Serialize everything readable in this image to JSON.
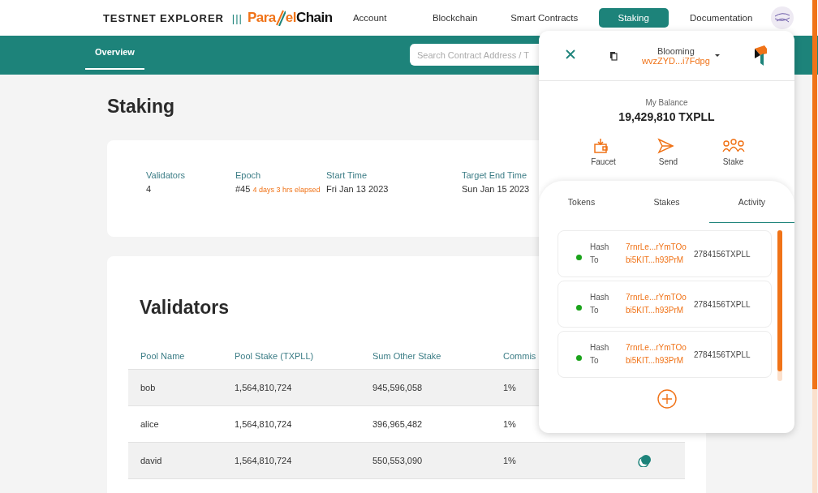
{
  "header": {
    "brand": "TESTNET EXPLORER",
    "separator": "|||",
    "logo": {
      "lead": "Para",
      "mid": "el",
      "tail": "Chain"
    },
    "nav": [
      {
        "label": "Account",
        "selected": false
      },
      {
        "label": "Blockchain",
        "selected": false
      },
      {
        "label": "Smart Contracts",
        "selected": false
      },
      {
        "label": "Staking",
        "selected": true
      },
      {
        "label": "Documentation",
        "selected": false
      }
    ]
  },
  "subnav": {
    "tabs": [
      {
        "label": "Overview",
        "selected": true
      }
    ],
    "search": {
      "placeholder": "Search Contract Address / T"
    }
  },
  "page": {
    "title": "Staking",
    "stats": [
      {
        "label": "Validators",
        "value": "4"
      },
      {
        "label": "Epoch",
        "value": "#45",
        "note": "4 days 3 hrs elapsed"
      },
      {
        "label": "Start Time",
        "value": "Fri Jan 13 2023"
      },
      {
        "label": "Target End Time",
        "value": "Sun Jan 15 2023"
      }
    ],
    "validators": {
      "title": "Validators",
      "columns": [
        "Pool Name",
        "Pool Stake (TXPLL)",
        "Sum Other Stake",
        "Commis"
      ],
      "rows": [
        {
          "cells": [
            "bob",
            "1,564,810,724",
            "945,596,058",
            "1%"
          ],
          "action_icon": false
        },
        {
          "cells": [
            "alice",
            "1,564,810,724",
            "396,965,482",
            "1%"
          ],
          "action_icon": false
        },
        {
          "cells": [
            "david",
            "1,564,810,724",
            "550,553,090",
            "1%"
          ],
          "action_icon": true
        }
      ]
    }
  },
  "wallet": {
    "network": "Blooming",
    "address": "wvzZYD...i7Fdpg",
    "balance_label": "My Balance",
    "balance": "19,429,810 TXPLL",
    "actions": [
      {
        "label": "Faucet",
        "kind": "faucet"
      },
      {
        "label": "Send",
        "kind": "send"
      },
      {
        "label": "Stake",
        "kind": "stake"
      }
    ],
    "tabs": [
      {
        "label": "Tokens",
        "selected": false
      },
      {
        "label": "Stakes",
        "selected": false
      },
      {
        "label": "Activity",
        "selected": true
      }
    ],
    "activity": [
      {
        "hash_label": "Hash",
        "to_label": "To",
        "hash": "7rnrLe...rYmTOo",
        "to": "bi5KIT...h93PrM",
        "amount": "2784156TXPLL"
      },
      {
        "hash_label": "Hash",
        "to_label": "To",
        "hash": "7rnrLe...rYmTOo",
        "to": "bi5KIT...h93PrM",
        "amount": "2784156TXPLL"
      },
      {
        "hash_label": "Hash",
        "to_label": "To",
        "hash": "7rnrLe...rYmTOo",
        "to": "bi5KIT...h93PrM",
        "amount": "2784156TXPLL"
      }
    ]
  }
}
